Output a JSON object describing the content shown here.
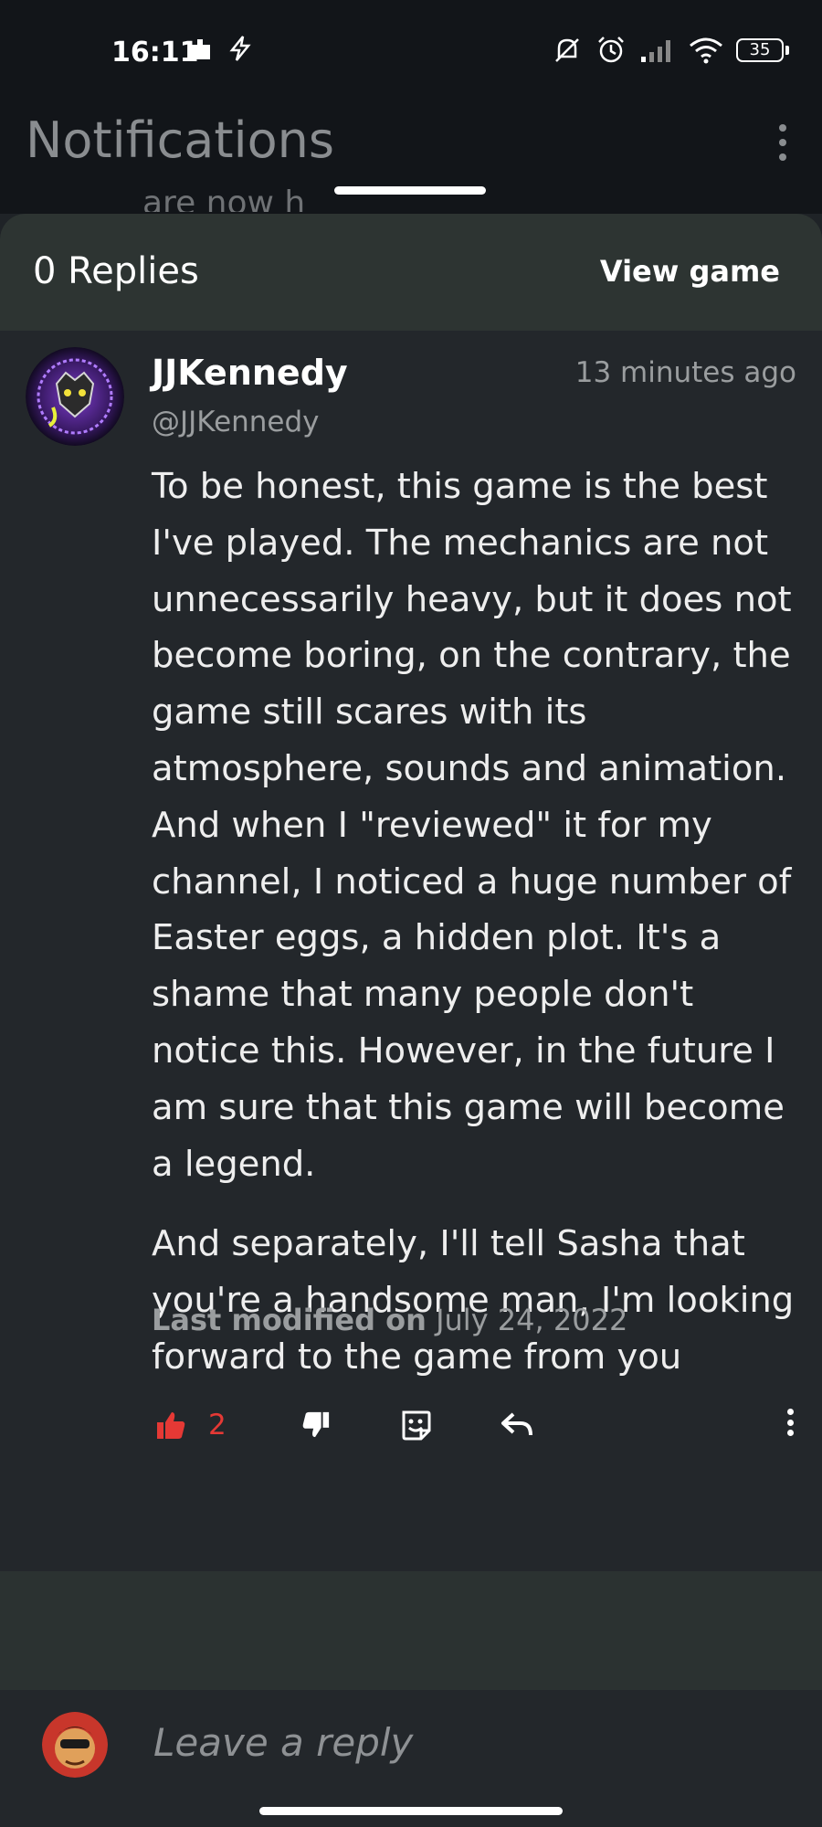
{
  "status_bar": {
    "time": "16:11",
    "battery": "35",
    "icons": [
      "notification-icon",
      "charging-flash-icon",
      "mute-icon",
      "alarm-icon",
      "signal-icon",
      "wifi-icon",
      "battery-icon"
    ]
  },
  "app_bar": {
    "title": "Notifications",
    "behind_text": "are now h"
  },
  "sheet": {
    "replies_title": "0 Replies",
    "view_game_label": "View game"
  },
  "comment": {
    "author_name": "JJKennedy",
    "author_handle": "@JJKennedy",
    "timestamp": "13 minutes ago",
    "paragraph_1": "To be honest, this game is the best I've played. The mechanics are not unnecessarily heavy, but it does not become boring, on the contrary, the game still scares with its atmosphere, sounds and animation. And when I \"reviewed\" it for my channel, I noticed a huge number of Easter eggs, a hidden plot. It's a shame that many people don't notice this. However, in the future I am sure that this game will become a legend.",
    "paragraph_2": "And separately, I'll tell Sasha that you're a handsome man, I'm looking forward to the game from you",
    "modified_label": "Last modified on",
    "modified_date": "July 24, 2022",
    "like_count": "2"
  },
  "reply": {
    "placeholder": "Leave a reply"
  },
  "colors": {
    "accent_like": "#e53935",
    "sheet_header": "#2d3432",
    "background": "#1f2327"
  }
}
